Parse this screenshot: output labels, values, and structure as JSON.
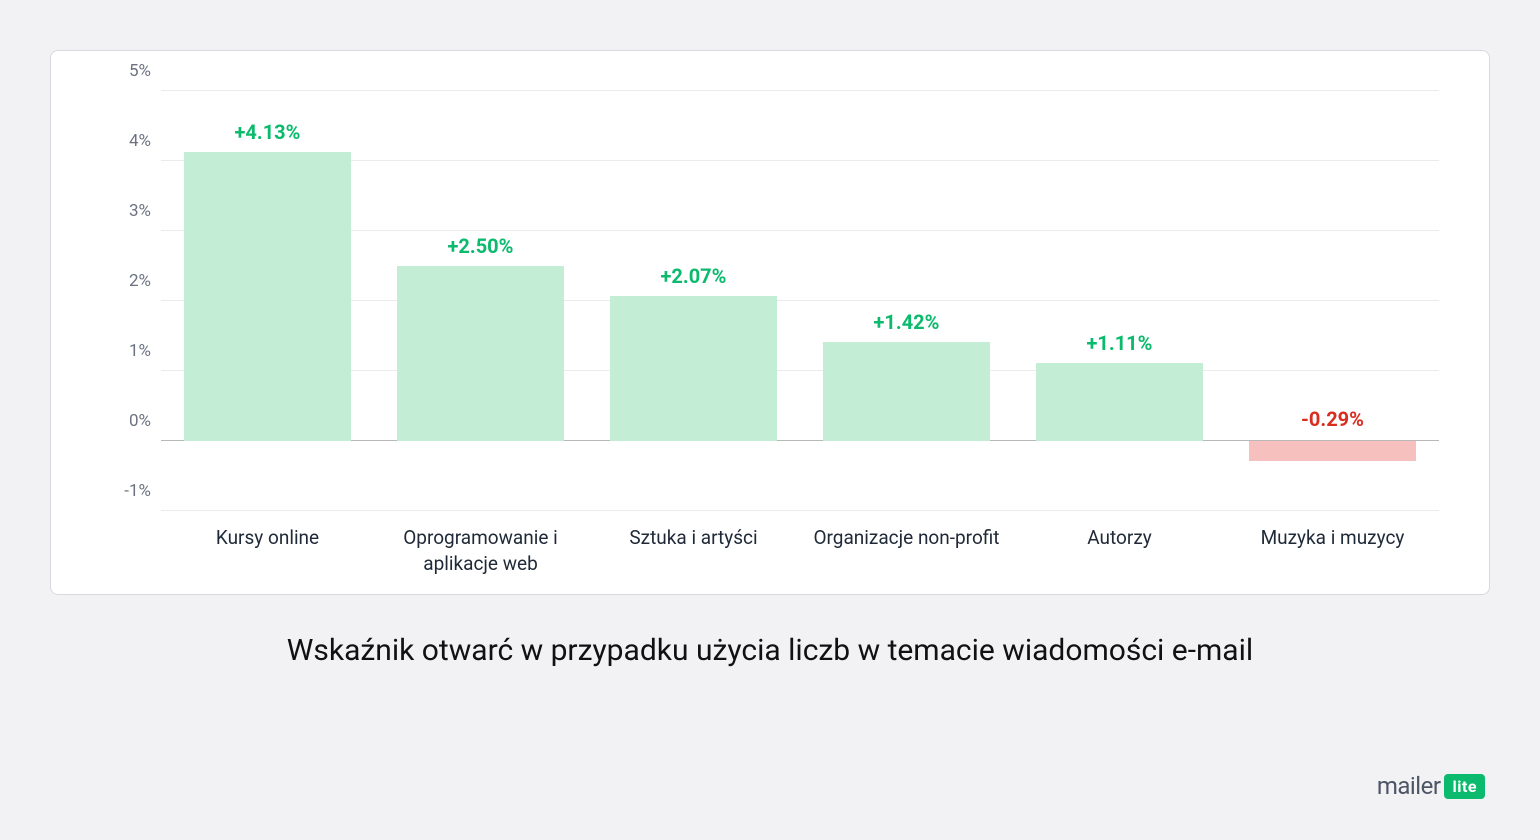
{
  "chart_data": {
    "type": "bar",
    "categories": [
      "Kursy online",
      "Oprogramowanie i aplikacje web",
      "Sztuka i artyści",
      "Organizacje non-profit",
      "Autorzy",
      "Muzyka i muzycy"
    ],
    "values": [
      4.13,
      2.5,
      2.07,
      1.42,
      1.11,
      -0.29
    ],
    "value_labels": [
      "+4.13%",
      "+2.50%",
      "+2.07%",
      "+1.42%",
      "+1.11%",
      "-0.29%"
    ],
    "ylim": [
      -1,
      5
    ],
    "y_ticks": [
      -1,
      0,
      1,
      2,
      3,
      4,
      5
    ],
    "y_tick_labels": [
      "-1%",
      "0%",
      "1%",
      "2%",
      "3%",
      "4%",
      "5%"
    ]
  },
  "caption": "Wskaźnik otwarć w przypadku użycia liczb w temacie wiadomości e-mail",
  "branding": {
    "name": "mailer",
    "badge": "lite"
  },
  "colors": {
    "positive_bar": "#c3eed5",
    "negative_bar": "#f5c0be",
    "positive_label": "#0bba6c",
    "negative_label": "#d92d20"
  }
}
